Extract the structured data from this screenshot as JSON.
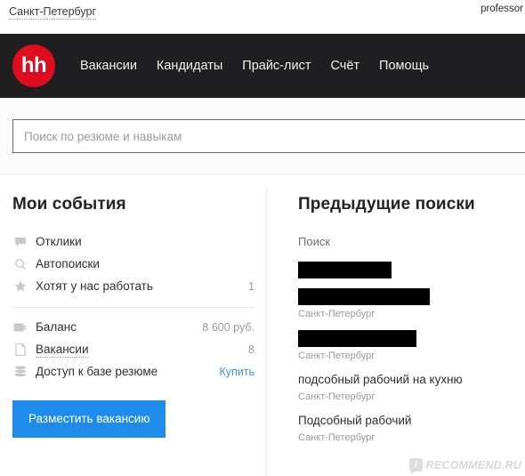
{
  "topbar": {
    "city": "Санкт-Петербург",
    "account": "professor"
  },
  "nav": {
    "logo_text": "hh",
    "items": [
      {
        "label": "Вакансии"
      },
      {
        "label": "Кандидаты"
      },
      {
        "label": "Прайс-лист"
      },
      {
        "label": "Счёт"
      },
      {
        "label": "Помощь"
      }
    ]
  },
  "search": {
    "placeholder": "Поиск по резюме и навыкам",
    "value": ""
  },
  "my_events": {
    "title": "Мои события",
    "items": [
      {
        "icon": "speech-bubble-icon",
        "label": "Отклики",
        "value": ""
      },
      {
        "icon": "magnifier-icon",
        "label": "Автопоиски",
        "value": ""
      },
      {
        "icon": "star-icon",
        "label": "Хотят у нас работать",
        "value": "1"
      }
    ],
    "account_items": [
      {
        "icon": "wallet-icon",
        "label": "Баланс",
        "value": "8 600 руб.",
        "value_is_link": false,
        "dotted": false
      },
      {
        "icon": "document-icon",
        "label": "Вакансии",
        "value": "8",
        "value_is_link": false,
        "dotted": true
      },
      {
        "icon": "database-icon",
        "label": "Доступ к базе резюме",
        "value": "Купить",
        "value_is_link": true,
        "dotted": false
      }
    ],
    "post_button": "Разместить вакансию"
  },
  "previous_searches": {
    "title": "Предыдущие поиски",
    "column_label": "Поиск",
    "entries": [
      {
        "redacted": true,
        "redacted_width": 105,
        "title": "",
        "city": ""
      },
      {
        "redacted": true,
        "redacted_width": 148,
        "title": "",
        "city": "Санкт-Петербург"
      },
      {
        "redacted": true,
        "redacted_width": 133,
        "title": "",
        "city": "Санкт-Петербург"
      },
      {
        "redacted": false,
        "redacted_width": 0,
        "title": "подсобный рабочий на кухню",
        "city": "Санкт-Петербург"
      },
      {
        "redacted": false,
        "redacted_width": 0,
        "title": "Подсобный рабочий",
        "city": "Санкт-Петербург"
      }
    ]
  },
  "watermark": {
    "badge": "I",
    "text": "RECOMMEND.RU"
  },
  "colors": {
    "brand_red": "#e00d20",
    "nav_dark": "#1f1f21",
    "accent_blue": "#1f8bea",
    "link_blue": "#3f90d6"
  }
}
